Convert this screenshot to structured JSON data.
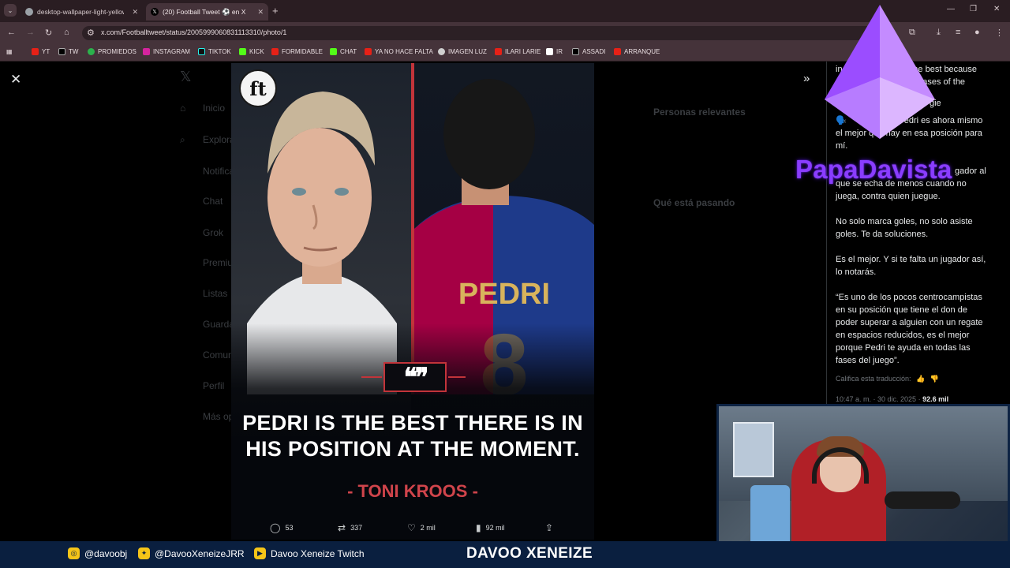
{
  "browser": {
    "tabs": [
      {
        "title": "desktop-wallpaper-light-yellow",
        "active": false
      },
      {
        "title": "(20) Football Tweet ⚽️ en X",
        "active": true
      }
    ],
    "url": "x.com/Footballtweet/status/2005999060831113310/photo/1",
    "bookmarks": [
      "YT",
      "TW",
      "PROMIEDOS",
      "INSTAGRAM",
      "TIKTOK",
      "KICK",
      "FORMIDABLE",
      "CHAT",
      "YA NO HACE FALTA",
      "IMAGEN LUZ",
      "ILARI LARIE",
      "IR",
      "ASSADI",
      "ARRANQUE"
    ]
  },
  "background": {
    "sidebar": [
      "Inicio",
      "Explorar",
      "Notificaciones",
      "Chat",
      "Grok",
      "Premium",
      "Listas",
      "Guardados",
      "Comunidades",
      "Perfil",
      "Más opciones"
    ],
    "right_sections": [
      "Personas relevantes",
      "Qué está pasando"
    ]
  },
  "photo": {
    "logo": "ft",
    "quote_mark": "❝❞",
    "quote": "PEDRI IS THE BEST THERE IS IN HIS POSITION AT THE MOMENT.",
    "author": "- TONI KROOS -"
  },
  "actions": {
    "replies": "53",
    "reposts": "337",
    "likes": "2 mil",
    "views": "92 mil"
  },
  "tweet_text": {
    "line1": "in the best because",
    "line2": "phases of the",
    "line3": "gie",
    "line4a": "edri es ahora mismo",
    "line4b": "el mejor que hay en esa posición para",
    "line4c": "mí.",
    "line5a": "gador al",
    "line5b": "que se echa de menos cuando no",
    "line5c": "juega, contra quien juegue.",
    "line6a": "No solo marca goles, no solo asiste",
    "line6b": "goles. Te da soluciones.",
    "line7a": "Es el mejor. Y si te falta un jugador así,",
    "line7b": "lo notarás.",
    "line8a": "“Es uno de los pocos centrocampistas",
    "line8b": "en su posición que tiene el don de",
    "line8c": "poder superar a alguien con un regate",
    "line8d": "en espacios reducidos, es el mejor",
    "line8e": "porque Pedri te ayuda en todas las",
    "line8f": "fases del juego”.",
    "rate_translation": "Califica esta traducción:",
    "timestamp": "10:47 a. m. · 30 dic. 2025 · ",
    "views": "92.6 mil"
  },
  "overlay": {
    "streamer_name": "PapaDavista",
    "socials": [
      {
        "icon": "instagram-icon",
        "label": "@davoobj"
      },
      {
        "icon": "twitter-icon",
        "label": "@DavooXeneizeJRR"
      },
      {
        "icon": "youtube-icon",
        "label": "Davoo Xeneize Twitch"
      }
    ],
    "channel": "DAVOO XENEIZE"
  },
  "colors": {
    "accent_red": "#c2343a",
    "overlay_bar": "#0a1f3f",
    "streamer_purple": "#8a3dff",
    "chrome": "#45333a"
  }
}
